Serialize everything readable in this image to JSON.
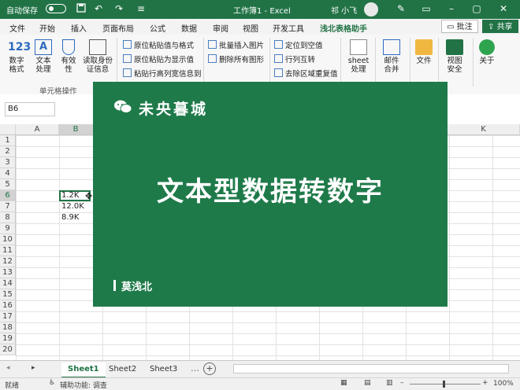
{
  "titlebar": {
    "autosave_label": "自动保存",
    "doc_title": "工作簿1 - Excel",
    "user_name": "祁 小飞"
  },
  "tabs": [
    "文件",
    "开始",
    "插入",
    "页面布局",
    "公式",
    "数据",
    "审阅",
    "视图",
    "开发工具",
    "浅北表格助手"
  ],
  "ribbon_actions": {
    "comment": "批注",
    "share": "共享"
  },
  "ribbon": {
    "number_format": "数字格式",
    "text_process": "文本处理",
    "valid": "有效性",
    "read_id": "读取身份证信息",
    "group_label": "单元格操作",
    "paste_value_format": "原位粘贴值与格式",
    "paste_display": "原位粘贴为显示值",
    "paste_row_height": "粘贴行高列宽信息到",
    "insert_images": "批量插入图片",
    "delete_shapes": "删除所有图形",
    "locate_empty": "定位到空值",
    "row_col_swap": "行列互转",
    "remove_dup": "去除区域重复值",
    "sheet_process": "sheet处理",
    "email_merge": "邮件合并",
    "file": "文件",
    "view_security": "视图安全",
    "about": "关于"
  },
  "namebox": "B6",
  "columns": [
    "A",
    "B",
    "K"
  ],
  "rows": [
    "1",
    "2",
    "3",
    "4",
    "5",
    "6",
    "7",
    "8",
    "9",
    "10",
    "11",
    "12",
    "13",
    "14",
    "15",
    "16",
    "17",
    "18",
    "19",
    "20"
  ],
  "cells": {
    "b6": "1.2K",
    "b7": "12.0K",
    "b8": "8.9K"
  },
  "card": {
    "brand": "未央暮城",
    "title": "文本型数据转数字",
    "author": "莫浅北"
  },
  "sheets": [
    "Sheet1",
    "Sheet2",
    "Sheet3"
  ],
  "status": {
    "ready": "就绪",
    "accessibility": "辅助功能: 调查",
    "zoom": "100%"
  },
  "colors": {
    "excel_green": "#217346",
    "card_green": "#1f7a4a"
  }
}
